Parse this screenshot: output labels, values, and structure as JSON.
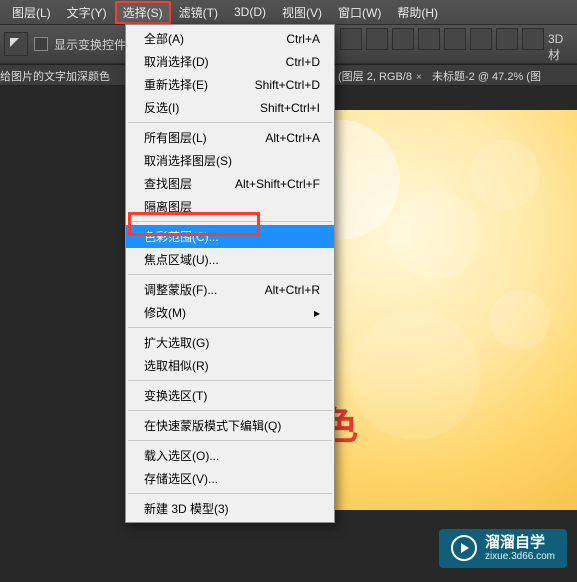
{
  "menubar": {
    "items": [
      {
        "label": "图层(L)"
      },
      {
        "label": "文字(Y)"
      },
      {
        "label": "选择(S)"
      },
      {
        "label": "滤镜(T)"
      },
      {
        "label": "3D(D)"
      },
      {
        "label": "视图(V)"
      },
      {
        "label": "窗口(W)"
      },
      {
        "label": "帮助(H)"
      }
    ],
    "active_index": 2
  },
  "options_bar": {
    "checkbox_label": "显示变换控件",
    "left_strip_text": "给图片的文字加深颜色",
    "right_label": "3D 材"
  },
  "doc_tabs": {
    "tab1": "(图层 2, RGB/8",
    "tab2": "未标题-2 @ 47.2% (图"
  },
  "dropdown": {
    "groups": [
      [
        {
          "label": "全部(A)",
          "shortcut": "Ctrl+A"
        },
        {
          "label": "取消选择(D)",
          "shortcut": "Ctrl+D"
        },
        {
          "label": "重新选择(E)",
          "shortcut": "Shift+Ctrl+D"
        },
        {
          "label": "反选(I)",
          "shortcut": "Shift+Ctrl+I"
        }
      ],
      [
        {
          "label": "所有图层(L)",
          "shortcut": "Alt+Ctrl+A"
        },
        {
          "label": "取消选择图层(S)",
          "shortcut": ""
        },
        {
          "label": "查找图层",
          "shortcut": "Alt+Shift+Ctrl+F"
        },
        {
          "label": "隔离图层",
          "shortcut": ""
        }
      ],
      [
        {
          "label": "色彩范围(C)...",
          "shortcut": "",
          "selected": true
        },
        {
          "label": "焦点区域(U)...",
          "shortcut": ""
        }
      ],
      [
        {
          "label": "调整蒙版(F)...",
          "shortcut": "Alt+Ctrl+R"
        },
        {
          "label": "修改(M)",
          "shortcut": "",
          "submenu": true
        }
      ],
      [
        {
          "label": "扩大选取(G)",
          "shortcut": ""
        },
        {
          "label": "选取相似(R)",
          "shortcut": ""
        }
      ],
      [
        {
          "label": "变换选区(T)",
          "shortcut": ""
        }
      ],
      [
        {
          "label": "在快速蒙版模式下编辑(Q)",
          "shortcut": ""
        }
      ],
      [
        {
          "label": "载入选区(O)...",
          "shortcut": ""
        },
        {
          "label": "存储选区(V)...",
          "shortcut": ""
        }
      ],
      [
        {
          "label": "新建 3D 模型(3)",
          "shortcut": ""
        }
      ]
    ]
  },
  "canvas": {
    "red_text_fragment": "色"
  },
  "watermark": {
    "title": "溜溜自学",
    "url": "zixue.3d66.com"
  },
  "colors": {
    "highlight_red": "#ff3b2f",
    "selection_blue": "#1e90ff",
    "watermark_bg": "#0f5f7a"
  }
}
